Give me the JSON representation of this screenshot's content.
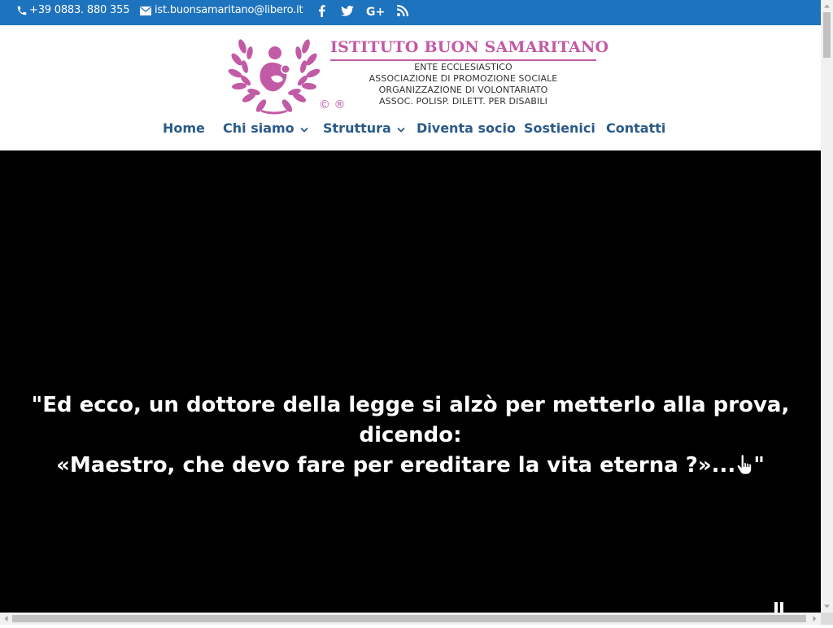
{
  "topbar": {
    "phone": "+39 0883. 880 355",
    "email": "ist.buonsamaritano@libero.it",
    "social": [
      "facebook-icon",
      "twitter-icon",
      "google-plus-icon",
      "rss-icon"
    ],
    "bg_color": "#1e73be"
  },
  "logo": {
    "title": "ISTITUTO BUON SAMARITANO",
    "lines": [
      "ENTE ECCLESIASTICO",
      "ASSOCIAZIONE DI PROMOZIONE SOCIALE",
      "ORGANIZZAZIONE DI VOLONTARIATO",
      "ASSOC. POLISP. DILETT. PER DISABILI"
    ],
    "marks": "© ®",
    "brand_color": "#c25aa5"
  },
  "nav": {
    "items": [
      {
        "label": "Home",
        "has_submenu": false
      },
      {
        "label": "Chi siamo",
        "has_submenu": true
      },
      {
        "label": "Struttura",
        "has_submenu": true
      },
      {
        "label": "Diventa socio",
        "has_submenu": false
      },
      {
        "label": "Sostienici",
        "has_submenu": false
      },
      {
        "label": "Contatti",
        "has_submenu": false
      }
    ],
    "color": "#2a5a8a"
  },
  "hero": {
    "line1": "\"Ed ecco, un dottore della legge si alzò per metterlo alla prova,",
    "line2": "dicendo:",
    "line3_start": "«Maestro, che devo fare per ereditare la vita eterna ?»...",
    "line3_end": "\"",
    "pointer_icon": "hand-pointer-icon",
    "pause_icon": "pause-icon"
  }
}
